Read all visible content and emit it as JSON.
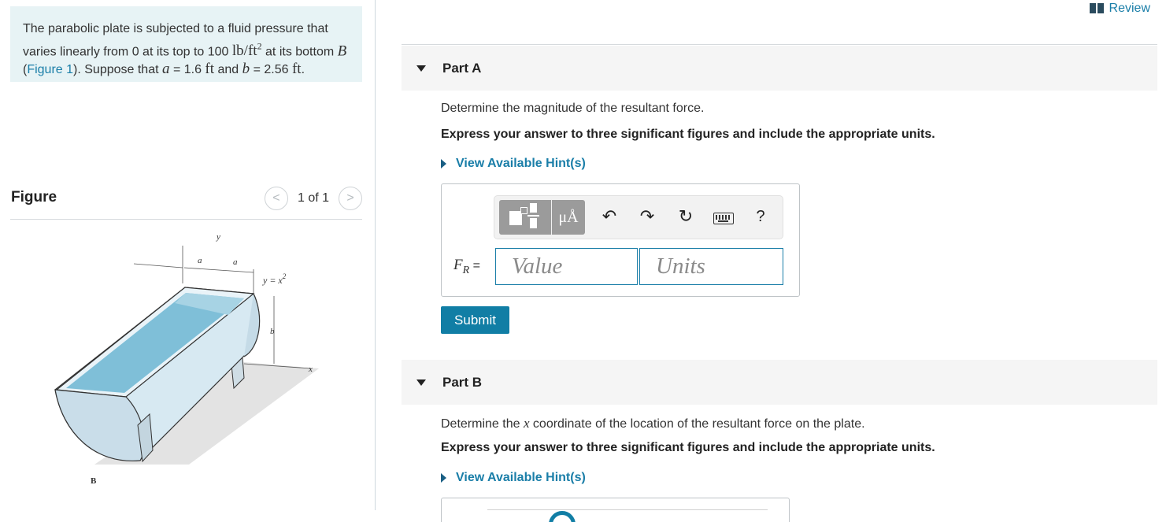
{
  "problem": {
    "text_1": "The parabolic plate is subjected to a fluid pressure that varies linearly from 0 at its top to 100 ",
    "units_pressure": "lb/ft",
    "units_exp": "2",
    "text_2": " at its bottom ",
    "point_b": "B",
    "text_3": " (",
    "figure_link": "Figure 1",
    "text_4": "). Suppose that ",
    "var_a": "a",
    "text_5": " = 1.6 ",
    "unit_ft_1": "ft",
    "text_6": " and ",
    "var_b": "b",
    "text_7": " = 2.56 ",
    "unit_ft_2": "ft",
    "text_8": "."
  },
  "figure": {
    "title": "Figure",
    "counter": "1 of 1",
    "prev": "<",
    "next": ">",
    "labels": {
      "y": "y",
      "a1": "a",
      "a2": "a",
      "eq_y": "y",
      "eq_rest": "= x",
      "eq_exp": "2",
      "b": "b",
      "x": "x",
      "B": "B"
    }
  },
  "header": {
    "review": "Review"
  },
  "part_a": {
    "label": "Part A",
    "question": "Determine the magnitude of the resultant force.",
    "instruction": "Express your answer to three significant figures and include the appropriate units.",
    "hint": "View Available Hint(s)",
    "toolbar": {
      "mu": "μÅ",
      "undo": "↶",
      "redo": "↷",
      "reset": "↻",
      "help": "?"
    },
    "answer_var": "F",
    "answer_sub": "R",
    "answer_eq": " =",
    "value_placeholder": "Value",
    "units_placeholder": "Units",
    "submit": "Submit"
  },
  "part_b": {
    "label": "Part B",
    "question_1": "Determine the ",
    "question_var": "x",
    "question_2": " coordinate of the location of the resultant force on the plate.",
    "instruction": "Express your answer to three significant figures and include the appropriate units.",
    "hint": "View Available Hint(s)"
  },
  "colors": {
    "link": "#1a7ea8",
    "problem_bg": "#e7f3f5",
    "submit_bg": "#117ea5",
    "part_bar_bg": "#f5f5f5",
    "fluid": "#7fbfd8"
  }
}
